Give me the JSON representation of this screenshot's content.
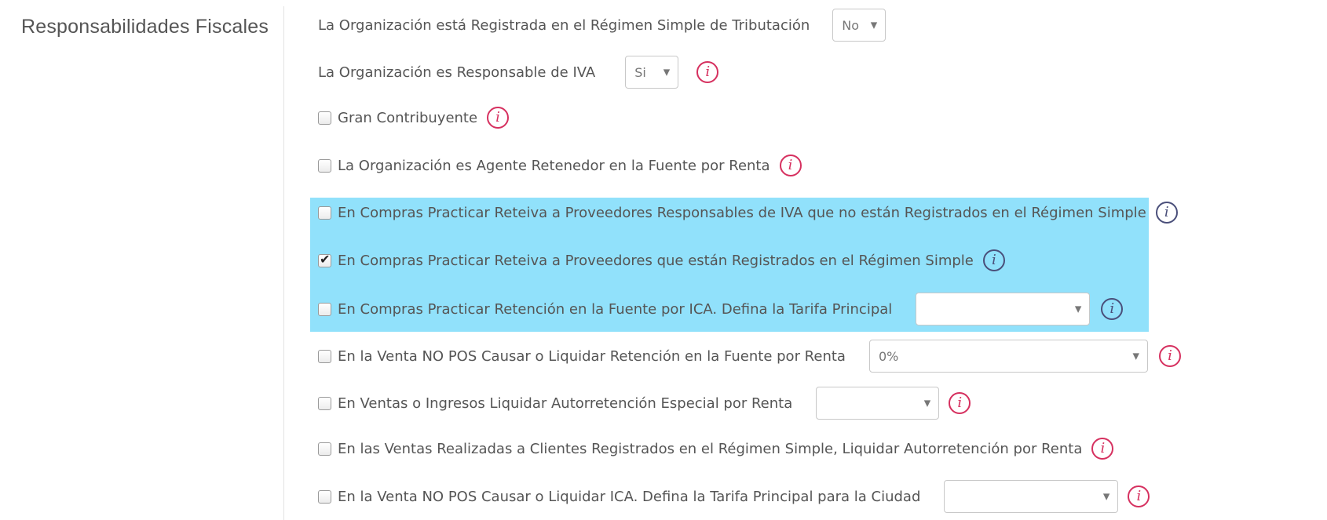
{
  "section": {
    "title": "Responsabilidades Fiscales"
  },
  "icons": {
    "info": "info-icon",
    "checkbox": "checkbox",
    "dropdown": "chevron-down-icon"
  },
  "colors": {
    "highlight": "#91e1fb",
    "info_icon": "#d6305f",
    "info_icon_highlighted": "#4a4f7a"
  },
  "fields": {
    "regimen_simple": {
      "label": "La Organización está Registrada en el Régimen Simple de Tributación",
      "value": "No"
    },
    "responsable_iva": {
      "label": "La Organización es Responsable de IVA",
      "value": "Si"
    },
    "gran_contribuyente": {
      "label": "Gran Contribuyente",
      "checked": false
    },
    "agente_retenedor": {
      "label": "La Organización es Agente Retenedor en la Fuente por Renta",
      "checked": false
    },
    "reteiva_responsables": {
      "label": "En Compras Practicar Reteiva a Proveedores Responsables de IVA que no están Registrados en el Régimen Simple",
      "checked": false
    },
    "reteiva_simple": {
      "label": "En Compras Practicar Reteiva a Proveedores que están Registrados en el Régimen Simple",
      "checked": true
    },
    "retencion_ica": {
      "label": "En Compras Practicar Retención en la Fuente por ICA. Defina la Tarifa Principal",
      "checked": false,
      "value": ""
    },
    "venta_retencion_renta": {
      "label": "En la Venta NO POS Causar o Liquidar Retención en la Fuente por Renta",
      "checked": false,
      "value": "0%"
    },
    "autorretencion_especial": {
      "label": "En Ventas o Ingresos Liquidar Autorretención Especial por Renta",
      "checked": false,
      "value": ""
    },
    "autorretencion_clientes_simple": {
      "label": "En las Ventas Realizadas a Clientes Registrados en el Régimen Simple, Liquidar Autorretención por Renta",
      "checked": false
    },
    "venta_ica": {
      "label": "En la Venta NO POS Causar o Liquidar ICA. Defina la Tarifa Principal para la Ciudad",
      "checked": false,
      "value": ""
    }
  }
}
